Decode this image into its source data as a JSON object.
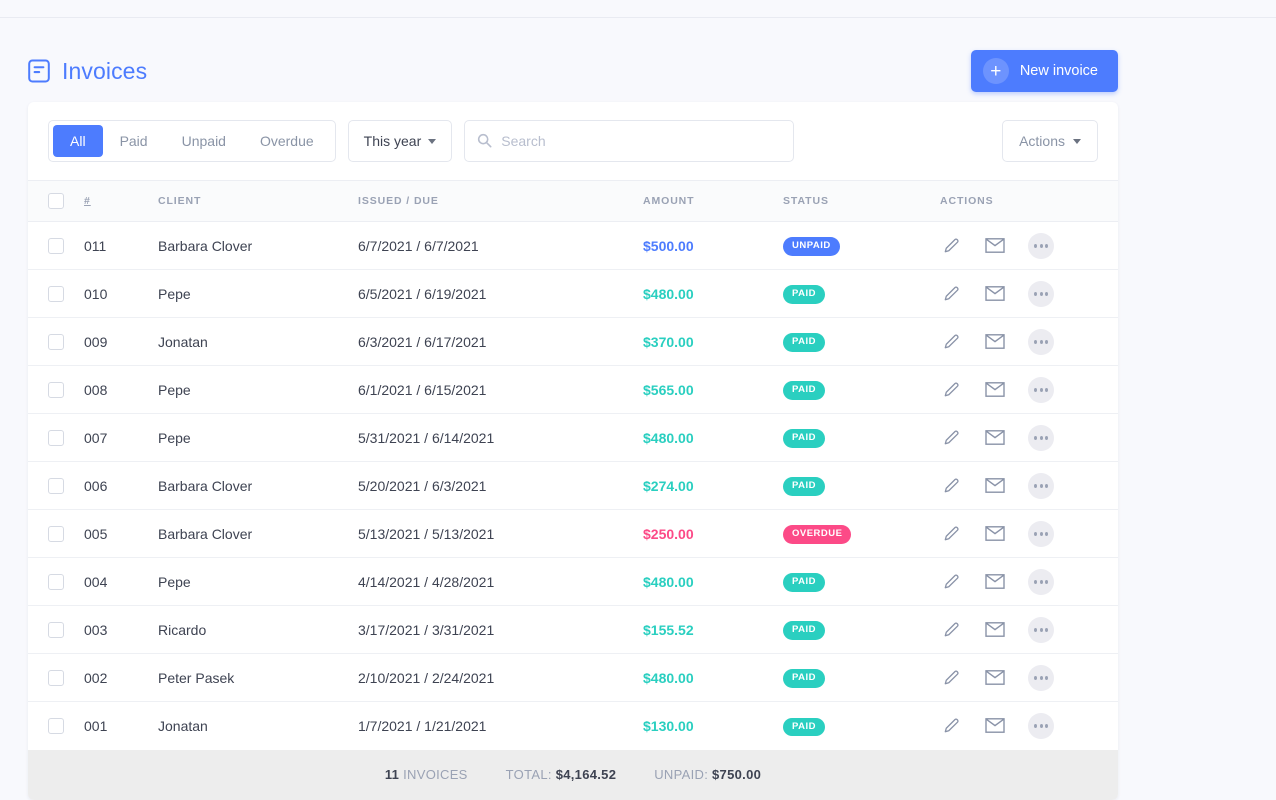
{
  "header": {
    "title": "Invoices",
    "icon": "document-list-icon",
    "new_invoice_label": "New invoice",
    "new_invoice_icon": "plus-icon"
  },
  "toolbar": {
    "tabs": [
      {
        "label": "All",
        "active": true
      },
      {
        "label": "Paid",
        "active": false
      },
      {
        "label": "Unpaid",
        "active": false
      },
      {
        "label": "Overdue",
        "active": false
      }
    ],
    "period_filter": "This year",
    "search_placeholder": "Search",
    "search_value": "",
    "search_icon": "search-icon",
    "actions_label": "Actions"
  },
  "table": {
    "columns": [
      "#",
      "CLIENT",
      "ISSUED / DUE",
      "AMOUNT",
      "STATUS",
      "ACTIONS"
    ],
    "rows": [
      {
        "num": "011",
        "client": "Barbara Clover",
        "dates": "6/7/2021 / 6/7/2021",
        "amount": "$500.00",
        "status": "UNPAID",
        "state": "unpaid"
      },
      {
        "num": "010",
        "client": "Pepe",
        "dates": "6/5/2021 / 6/19/2021",
        "amount": "$480.00",
        "status": "PAID",
        "state": "paid"
      },
      {
        "num": "009",
        "client": "Jonatan",
        "dates": "6/3/2021 / 6/17/2021",
        "amount": "$370.00",
        "status": "PAID",
        "state": "paid"
      },
      {
        "num": "008",
        "client": "Pepe",
        "dates": "6/1/2021 / 6/15/2021",
        "amount": "$565.00",
        "status": "PAID",
        "state": "paid"
      },
      {
        "num": "007",
        "client": "Pepe",
        "dates": "5/31/2021 / 6/14/2021",
        "amount": "$480.00",
        "status": "PAID",
        "state": "paid"
      },
      {
        "num": "006",
        "client": "Barbara Clover",
        "dates": "5/20/2021 / 6/3/2021",
        "amount": "$274.00",
        "status": "PAID",
        "state": "paid"
      },
      {
        "num": "005",
        "client": "Barbara Clover",
        "dates": "5/13/2021 / 5/13/2021",
        "amount": "$250.00",
        "status": "OVERDUE",
        "state": "overdue"
      },
      {
        "num": "004",
        "client": "Pepe",
        "dates": "4/14/2021 / 4/28/2021",
        "amount": "$480.00",
        "status": "PAID",
        "state": "paid"
      },
      {
        "num": "003",
        "client": "Ricardo",
        "dates": "3/17/2021 / 3/31/2021",
        "amount": "$155.52",
        "status": "PAID",
        "state": "paid"
      },
      {
        "num": "002",
        "client": "Peter Pasek",
        "dates": "2/10/2021 / 2/24/2021",
        "amount": "$480.00",
        "status": "PAID",
        "state": "paid"
      },
      {
        "num": "001",
        "client": "Jonatan",
        "dates": "1/7/2021 / 1/21/2021",
        "amount": "$130.00",
        "status": "PAID",
        "state": "paid"
      }
    ],
    "row_action_icons": [
      "edit-pencil-icon",
      "envelope-icon",
      "more-options-icon"
    ]
  },
  "footer": {
    "count": "11",
    "count_label": "INVOICES",
    "total_label": "TOTAL:",
    "total_value": "$4,164.52",
    "unpaid_label": "UNPAID:",
    "unpaid_value": "$750.00"
  },
  "colors": {
    "accent": "#4d7cfe",
    "paid": "#2acfc0",
    "overdue": "#fc4a87",
    "page_bg": "#f8f9fd",
    "footer_bg": "#ededed"
  }
}
